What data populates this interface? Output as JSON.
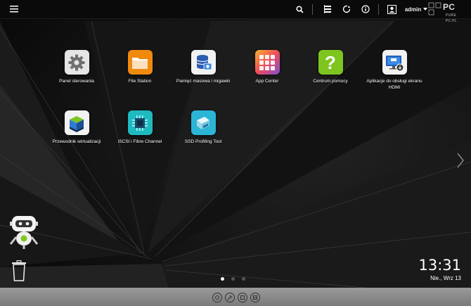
{
  "topbar": {
    "menu_icon": "hamburger-icon",
    "search_icon": "search-icon",
    "tasks_icon": "tasks-icon",
    "update_icon": "refresh-icon",
    "info_icon": "info-icon",
    "user_icon": "user-icon",
    "username": "admin",
    "logo": {
      "brand": "PC",
      "line1": "PURE",
      "line2": "PC.PL"
    }
  },
  "apps": [
    {
      "label": "Panel sterowania",
      "icon": "gear-icon",
      "color": "#e7e7e7"
    },
    {
      "label": "File Station",
      "icon": "folder-icon",
      "color": "#f08a0f"
    },
    {
      "label": "Pamięć masowa i migawki",
      "icon": "storage-icon",
      "color": "#f2f2f2"
    },
    {
      "label": "App Center",
      "icon": "app-grid-icon",
      "color": "#f36b3a"
    },
    {
      "label": "Centrum pomocy",
      "icon": "help-icon",
      "color": "#7ec520"
    },
    {
      "label": "Aplikacje do obsługi ekranu HDMI",
      "icon": "hdmi-monitor-icon",
      "color": "#f2f2f2"
    },
    {
      "label": "Przewodnik wirtualizacji",
      "icon": "virtualization-icon",
      "color": "#f2f2f2"
    },
    {
      "label": "iSCSI i Fibre Channel",
      "icon": "iscsi-chip-icon",
      "color": "#1fb9c0"
    },
    {
      "label": "SSD Profiling Tool",
      "icon": "ssd-icon",
      "color": "#2bb5d6"
    }
  ],
  "sidebar": {
    "assistant_icon": "robot-assistant-icon",
    "trash_icon": "trash-icon"
  },
  "clock": {
    "time": "13:31",
    "date": "Nie., Wrz 13"
  },
  "pagination": {
    "pages": 3,
    "active": 1
  },
  "dock": {
    "items": [
      "dock-1-icon",
      "dock-2-icon",
      "dock-3-icon",
      "dock-4-icon"
    ]
  }
}
